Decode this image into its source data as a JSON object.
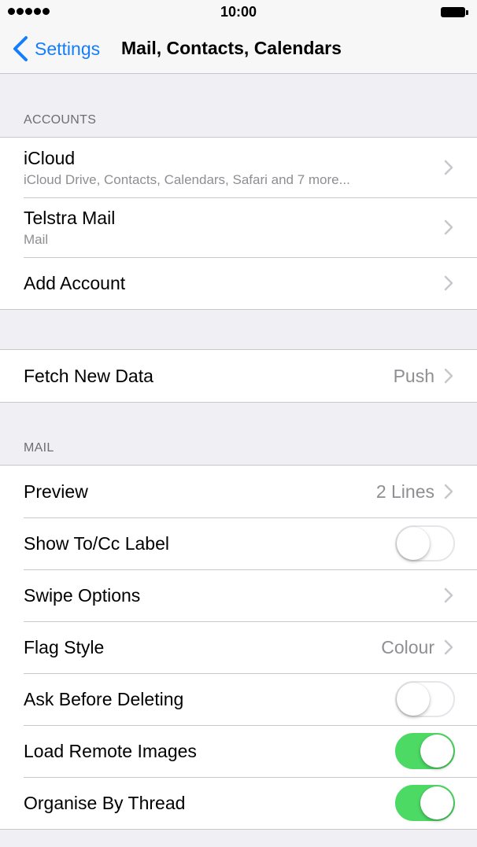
{
  "status_bar": {
    "time": "10:00"
  },
  "nav": {
    "back_label": "Settings",
    "title": "Mail, Contacts, Calendars"
  },
  "accounts": {
    "header": "ACCOUNTS",
    "items": [
      {
        "title": "iCloud",
        "subtitle": "iCloud Drive, Contacts, Calendars, Safari and 7 more..."
      },
      {
        "title": "Telstra Mail",
        "subtitle": "Mail"
      },
      {
        "title": "Add Account"
      }
    ]
  },
  "fetch": {
    "title": "Fetch New Data",
    "value": "Push"
  },
  "mail": {
    "header": "MAIL",
    "preview": {
      "title": "Preview",
      "value": "2 Lines"
    },
    "show_to_cc": {
      "title": "Show To/Cc Label",
      "enabled": false
    },
    "swipe": {
      "title": "Swipe Options"
    },
    "flag_style": {
      "title": "Flag Style",
      "value": "Colour"
    },
    "ask_before_deleting": {
      "title": "Ask Before Deleting",
      "enabled": false
    },
    "load_remote_images": {
      "title": "Load Remote Images",
      "enabled": true
    },
    "organise_by_thread": {
      "title": "Organise By Thread",
      "enabled": true
    }
  },
  "colors": {
    "accent": "#147efb",
    "toggle_on": "#4cd964",
    "background": "#efeff4"
  }
}
